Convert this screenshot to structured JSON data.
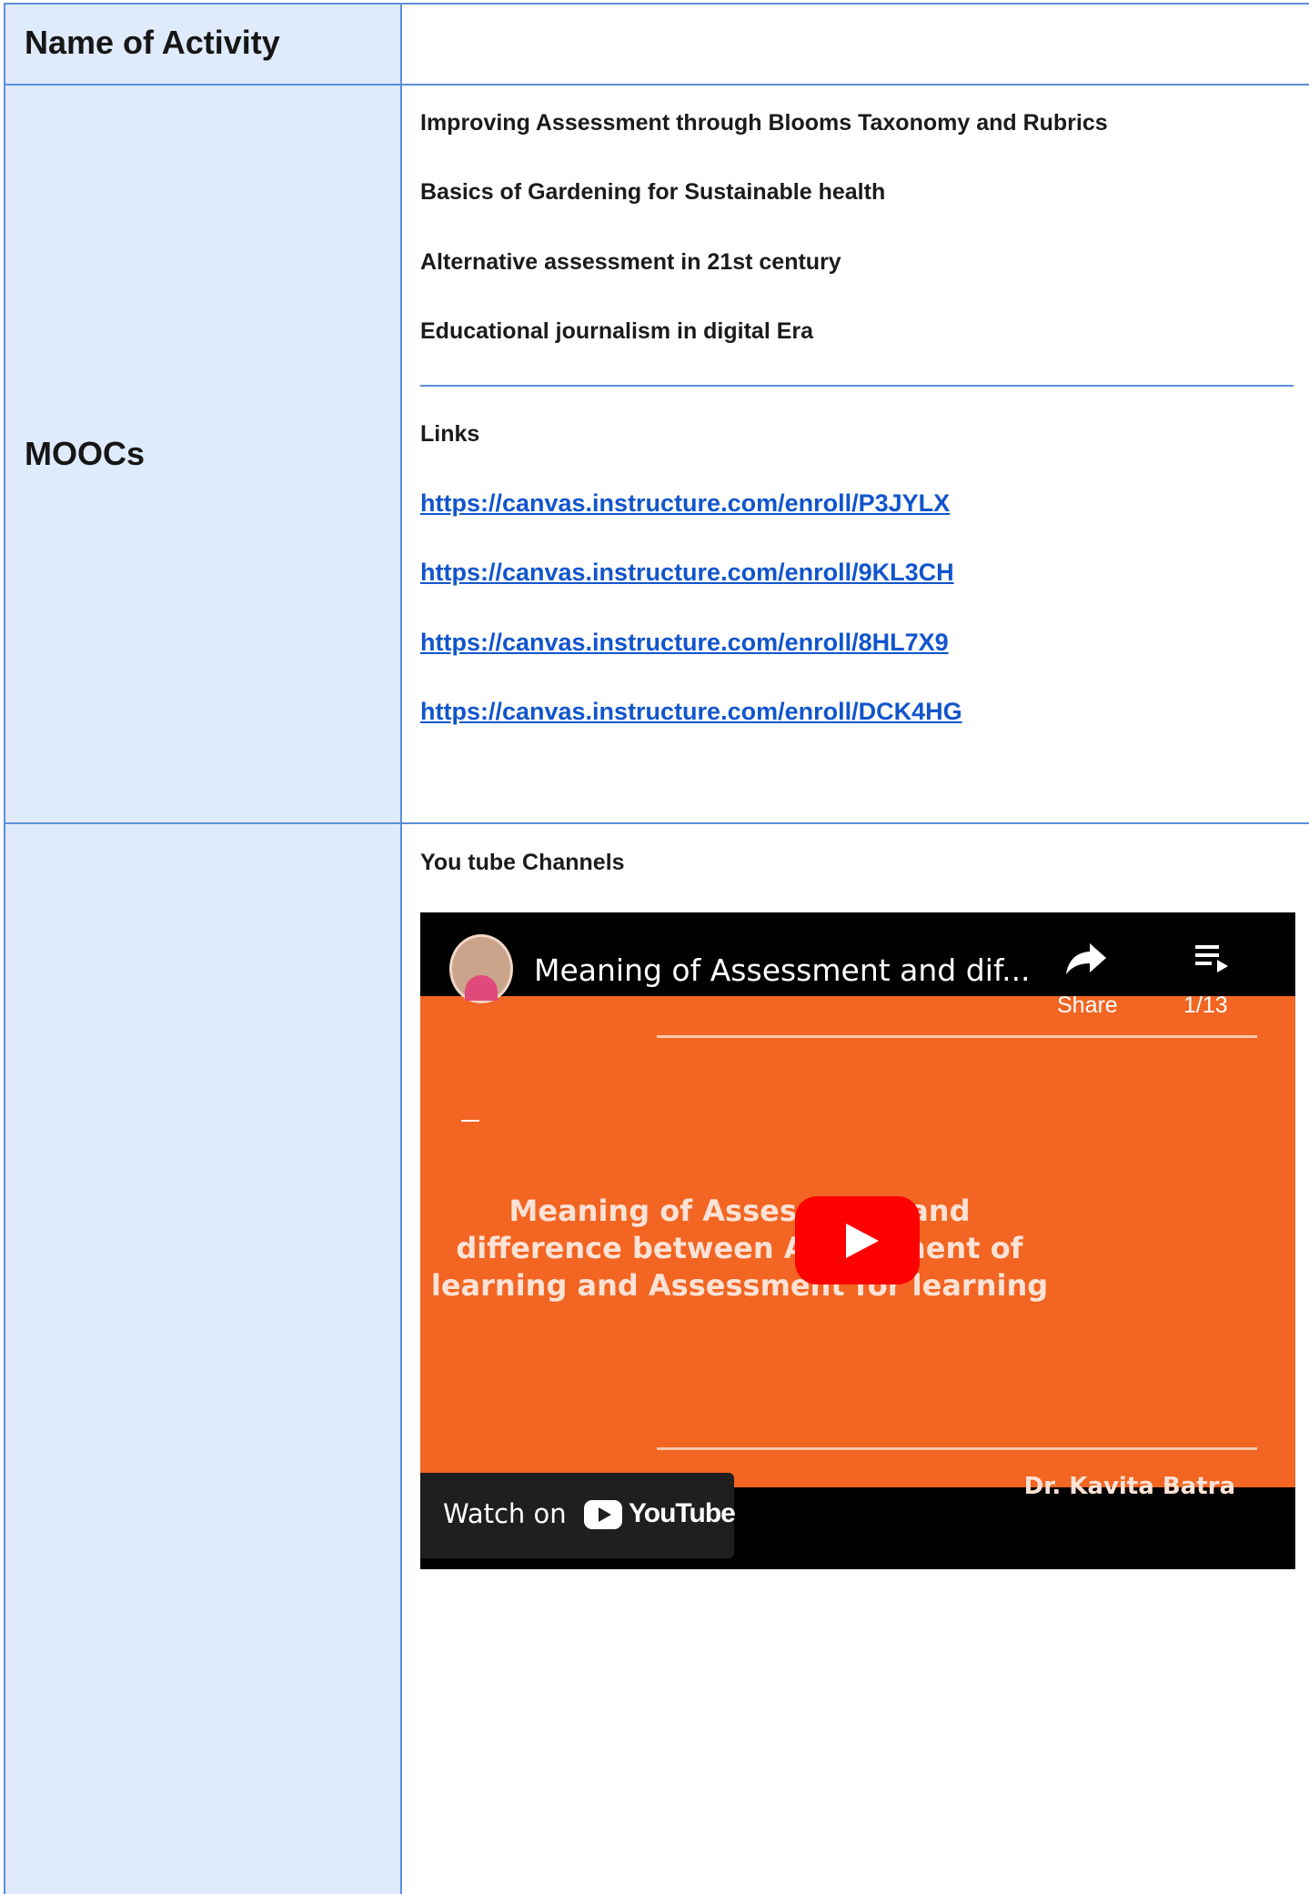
{
  "table": {
    "header_label": "Name of Activity",
    "mooc_label": "MOOCs"
  },
  "moocs": {
    "items": [
      "Improving Assessment through Blooms Taxonomy and Rubrics",
      "Basics of Gardening for Sustainable health",
      "Alternative assessment in 21st century",
      "Educational journalism in digital Era"
    ],
    "links_heading": "Links",
    "links": [
      "https://canvas.instructure.com/enroll/P3JYLX",
      "https://canvas.instructure.com/enroll/9KL3CH",
      "https://canvas.instructure.com/enroll/8HL7X9",
      "https://canvas.instructure.com/enroll/DCK4HG"
    ]
  },
  "youtube": {
    "heading": "You tube Channels",
    "video_title": "Meaning of Assessment and dif...",
    "share_label": "Share",
    "playlist_count": "1/13",
    "slide_lines": [
      "Meaning of Assessment and",
      "difference between Assessment of",
      "learning and Assessment for learning"
    ],
    "slide_author": "Dr. Kavita Batra",
    "watch_on": "Watch on",
    "youtube_word": "YouTube"
  },
  "colors": {
    "border": "#5b8fd9",
    "left_column_bg": "#dfeafb",
    "link": "#1155cc",
    "video_slide": "#f26522",
    "play_button": "#ff0000"
  }
}
